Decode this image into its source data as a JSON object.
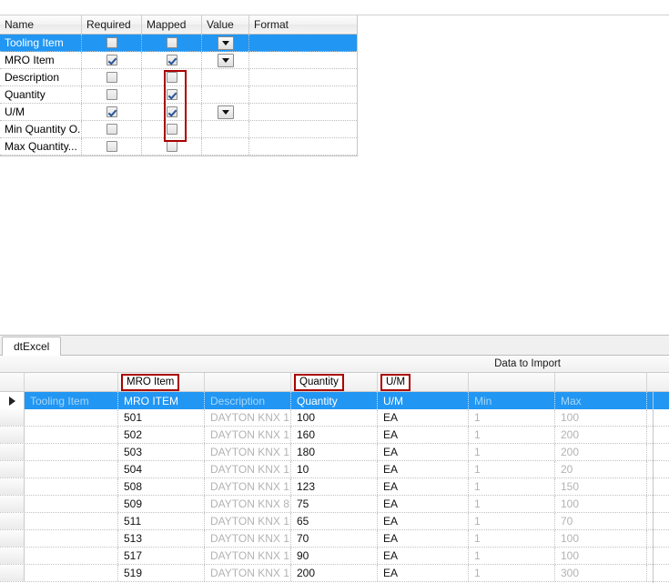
{
  "mapping_grid": {
    "columns": [
      "Name",
      "Required",
      "Mapped",
      "Value",
      "Format"
    ],
    "rows": [
      {
        "name": "Tooling Item",
        "required": false,
        "mapped": false,
        "has_value_dropdown": true,
        "format": "",
        "selected": true
      },
      {
        "name": "MRO Item",
        "required": true,
        "mapped": true,
        "has_value_dropdown": true,
        "format": "",
        "selected": false
      },
      {
        "name": "Description",
        "required": false,
        "mapped": false,
        "has_value_dropdown": false,
        "format": "",
        "selected": false
      },
      {
        "name": "Quantity",
        "required": false,
        "mapped": true,
        "has_value_dropdown": false,
        "format": "",
        "selected": false
      },
      {
        "name": "U/M",
        "required": true,
        "mapped": true,
        "has_value_dropdown": true,
        "format": "",
        "selected": false
      },
      {
        "name": "Min Quantity O...",
        "required": false,
        "mapped": false,
        "has_value_dropdown": false,
        "format": "",
        "selected": false
      },
      {
        "name": "Max Quantity...",
        "required": false,
        "mapped": false,
        "has_value_dropdown": false,
        "format": "",
        "selected": false
      }
    ],
    "highlight_color": "#aa0000",
    "selection_color": "#2196F3"
  },
  "bottom_pane": {
    "tab_label": "dtExcel",
    "band_label": "Data to Import",
    "mapping_labels": {
      "tooling_item": "",
      "mro_item": "MRO Item",
      "description": "",
      "quantity": "Quantity",
      "um": "U/M",
      "min": "",
      "max": ""
    },
    "data_grid": {
      "headers": [
        "Tooling Item",
        "MRO ITEM",
        "Description",
        "Quantity",
        "U/M",
        "Min",
        "Max"
      ],
      "rows": [
        {
          "tooling_item": "",
          "mro_item": "501",
          "description": "DAYTON KNX 1...",
          "quantity": "100",
          "um": "EA",
          "min": "1",
          "max": "100"
        },
        {
          "tooling_item": "",
          "mro_item": "502",
          "description": "DAYTON KNX 1...",
          "quantity": "160",
          "um": "EA",
          "min": "1",
          "max": "200"
        },
        {
          "tooling_item": "",
          "mro_item": "503",
          "description": "DAYTON KNX 1...",
          "quantity": "180",
          "um": "EA",
          "min": "1",
          "max": "200"
        },
        {
          "tooling_item": "",
          "mro_item": "504",
          "description": "DAYTON KNX 1...",
          "quantity": "10",
          "um": "EA",
          "min": "1",
          "max": "20"
        },
        {
          "tooling_item": "",
          "mro_item": "508",
          "description": "DAYTON KNX 1...",
          "quantity": "123",
          "um": "EA",
          "min": "1",
          "max": "150"
        },
        {
          "tooling_item": "",
          "mro_item": "509",
          "description": "DAYTON KNX 8...",
          "quantity": "75",
          "um": "EA",
          "min": "1",
          "max": "100"
        },
        {
          "tooling_item": "",
          "mro_item": "511",
          "description": "DAYTON KNX 1...",
          "quantity": "65",
          "um": "EA",
          "min": "1",
          "max": "70"
        },
        {
          "tooling_item": "",
          "mro_item": "513",
          "description": "DAYTON KNX 1...",
          "quantity": "70",
          "um": "EA",
          "min": "1",
          "max": "100"
        },
        {
          "tooling_item": "",
          "mro_item": "517",
          "description": "DAYTON KNX 1...",
          "quantity": "90",
          "um": "EA",
          "min": "1",
          "max": "100"
        },
        {
          "tooling_item": "",
          "mro_item": "519",
          "description": "DAYTON KNX 1...",
          "quantity": "200",
          "um": "EA",
          "min": "1",
          "max": "300"
        }
      ]
    }
  }
}
